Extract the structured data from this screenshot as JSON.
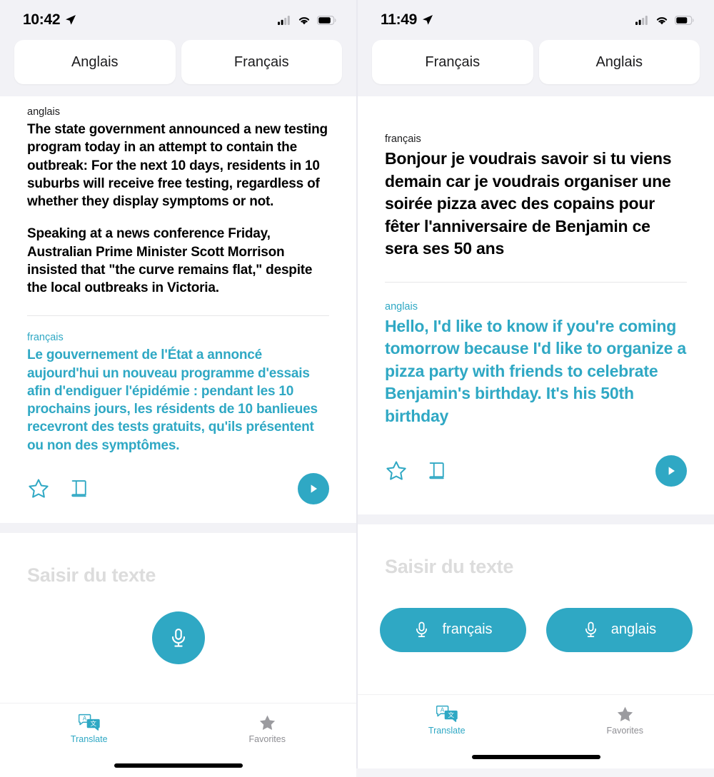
{
  "accent_color": "#2FA8C4",
  "panels": [
    {
      "id": "panel-left",
      "status": {
        "time": "10:42",
        "location_icon": "location-arrow-icon",
        "signal_icon": "cellular-signal-icon",
        "wifi_icon": "wifi-icon",
        "battery_icon": "battery-icon"
      },
      "language_selector": {
        "source": "Anglais",
        "target": "Français"
      },
      "translation": {
        "source_label": "anglais",
        "source_paragraphs": [
          "The state government announced a new testing program today in an attempt to contain the outbreak: For the next 10 days, residents in 10 suburbs will receive free testing, regardless of whether they display symptoms or not.",
          "Speaking at a news conference Friday, Australian Prime Minister Scott Morrison insisted that \"the curve remains flat,\" despite the local outbreaks in Victoria."
        ],
        "target_label": "français",
        "target_text": "Le gouvernement de l'État a annoncé aujourd'hui un nouveau programme d'essais afin d'endiguer l'épidémie : pendant les 10 prochains jours, les résidents de 10 banlieues recevront des tests gratuits, qu'ils présentent ou non des symptômes."
      },
      "actions": {
        "favorite_icon": "star-outline-icon",
        "dictionary_icon": "book-icon",
        "play_icon": "play-icon"
      },
      "input": {
        "placeholder": "Saisir du texte",
        "mic_mode": "single",
        "mic_buttons": []
      },
      "tabs": [
        {
          "label": "Translate",
          "icon": "translate-bubbles-icon",
          "active": true
        },
        {
          "label": "Favorites",
          "icon": "star-filled-icon",
          "active": false
        }
      ]
    },
    {
      "id": "panel-right",
      "status": {
        "time": "11:49",
        "location_icon": "location-arrow-icon",
        "signal_icon": "cellular-signal-icon",
        "wifi_icon": "wifi-icon",
        "battery_icon": "battery-icon"
      },
      "language_selector": {
        "source": "Français",
        "target": "Anglais"
      },
      "translation": {
        "source_label": "français",
        "source_paragraphs": [
          "Bonjour je voudrais savoir si tu viens demain car je voudrais organiser une soirée pizza avec des copains pour fêter l'anniversaire de Benjamin ce sera ses 50 ans"
        ],
        "target_label": "anglais",
        "target_text": "Hello, I'd like to know if you're coming tomorrow because I'd like to organize a pizza party with friends to celebrate Benjamin's birthday. It's his 50th birthday"
      },
      "actions": {
        "favorite_icon": "star-outline-icon",
        "dictionary_icon": "book-icon",
        "play_icon": "play-icon"
      },
      "input": {
        "placeholder": "Saisir du texte",
        "mic_mode": "dual",
        "mic_buttons": [
          "français",
          "anglais"
        ]
      },
      "tabs": [
        {
          "label": "Translate",
          "icon": "translate-bubbles-icon",
          "active": true
        },
        {
          "label": "Favorites",
          "icon": "star-filled-icon",
          "active": false
        }
      ]
    }
  ]
}
